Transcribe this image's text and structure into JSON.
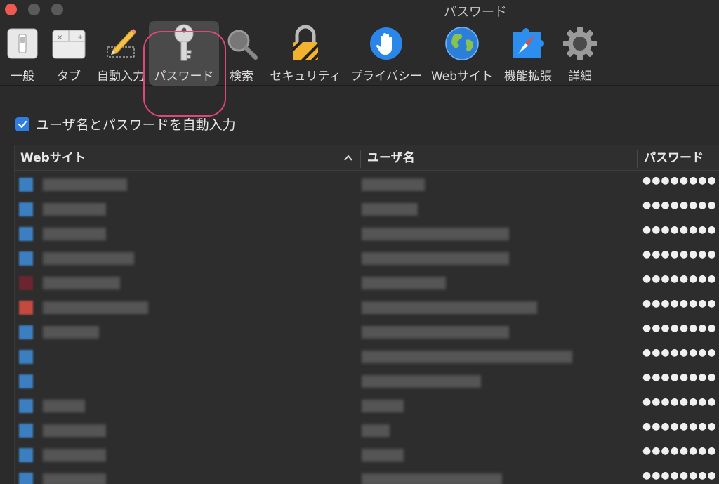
{
  "window": {
    "title": "パスワード"
  },
  "toolbar": {
    "items": [
      {
        "label": "一般",
        "icon": "general-switch-icon"
      },
      {
        "label": "タブ",
        "icon": "tabs-window-icon"
      },
      {
        "label": "自動入力",
        "icon": "autofill-pencil-icon"
      },
      {
        "label": "パスワード",
        "icon": "key-icon",
        "selected": true
      },
      {
        "label": "検索",
        "icon": "magnifier-icon"
      },
      {
        "label": "セキュリティ",
        "icon": "padlock-icon"
      },
      {
        "label": "プライバシー",
        "icon": "privacy-hand-icon"
      },
      {
        "label": "Webサイト",
        "icon": "globe-icon"
      },
      {
        "label": "機能拡張",
        "icon": "extensions-puzzle-icon"
      },
      {
        "label": "詳細",
        "icon": "gear-icon"
      }
    ]
  },
  "autofill": {
    "label": "ユーザ名とパスワードを自動入力",
    "checked": true
  },
  "table": {
    "columns": [
      "Webサイト",
      "ユーザ名",
      "パスワード"
    ],
    "sort": "ascending",
    "rows": [
      {
        "password": "●●●●●●●●"
      },
      {
        "password": "●●●●●●●●"
      },
      {
        "password": "●●●●●●●●"
      },
      {
        "password": "●●●●●●●●"
      },
      {
        "password": "●●●●●●●●"
      },
      {
        "password": "●●●●●●●●"
      },
      {
        "password": "●●●●●●●●"
      },
      {
        "password": "●●●●●●●●"
      },
      {
        "password": "●●●●●●●●"
      },
      {
        "password": "●●●●●●●●"
      },
      {
        "password": "●●●●●●●●"
      },
      {
        "password": "●●●●●●●●"
      },
      {
        "password": "●●●●●●●●"
      }
    ]
  },
  "colors": {
    "accent": "#2f7de1",
    "highlight": "#e0457b",
    "background": "#2b2b2b"
  }
}
